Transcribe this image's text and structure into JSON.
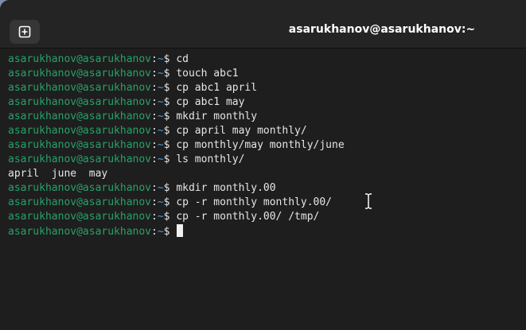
{
  "window": {
    "title": "asarukhanov@asarukhanov:~"
  },
  "prompt": {
    "user_host": "asarukhanov@asarukhanov",
    "sep": ":",
    "path": "~",
    "symbol": "$"
  },
  "terminal": {
    "lines": [
      {
        "type": "cmd",
        "text": "cd"
      },
      {
        "type": "cmd",
        "text": "touch abc1"
      },
      {
        "type": "cmd",
        "text": "cp abc1 april"
      },
      {
        "type": "cmd",
        "text": "cp abc1 may"
      },
      {
        "type": "cmd",
        "text": "mkdir monthly"
      },
      {
        "type": "cmd",
        "text": "cp april may monthly/"
      },
      {
        "type": "cmd",
        "text": "cp monthly/may monthly/june"
      },
      {
        "type": "cmd",
        "text": "ls monthly/"
      },
      {
        "type": "out",
        "text": "april  june  may"
      },
      {
        "type": "cmd",
        "text": "mkdir monthly.00"
      },
      {
        "type": "cmd",
        "text": "cp -r monthly monthly.00/"
      },
      {
        "type": "cmd",
        "text": "cp -r monthly.00/ /tmp/"
      },
      {
        "type": "cmd",
        "text": ""
      }
    ]
  },
  "icons": {
    "new_tab": "plus-box-icon",
    "text_cursor": "i-beam-cursor-icon"
  }
}
